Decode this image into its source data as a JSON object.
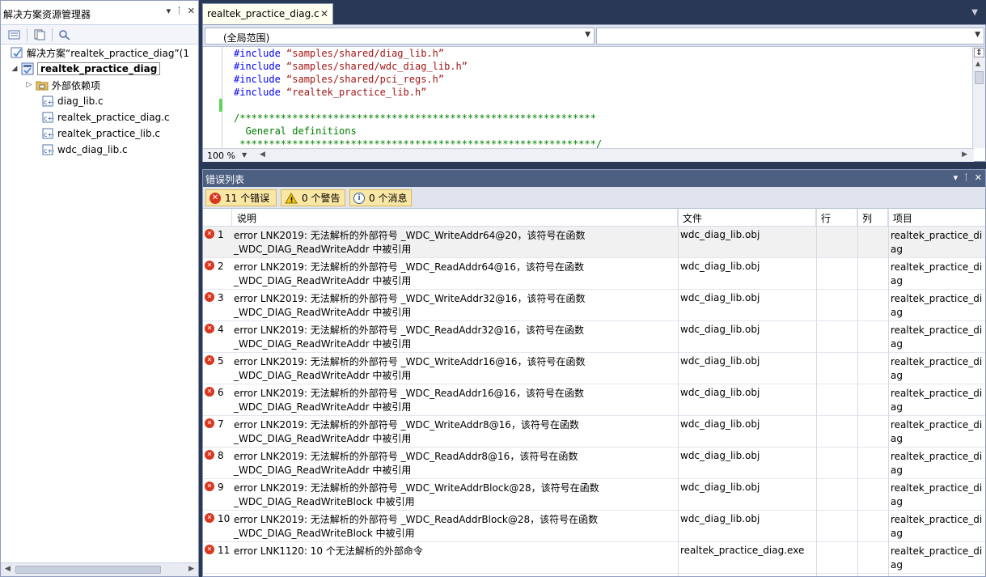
{
  "solution_explorer": {
    "title": "解决方案资源管理器",
    "solution_label": "解决方案“realtek_practice_diag”(1",
    "project": "realtek_practice_diag",
    "external_deps": "外部依赖项",
    "files": [
      "diag_lib.c",
      "realtek_practice_diag.c",
      "realtek_practice_lib.c",
      "wdc_diag_lib.c"
    ]
  },
  "editor": {
    "tab_label": "realtek_practice_diag.c",
    "scope_combo": "(全局范围)",
    "member_combo": "",
    "zoom": "100 %",
    "lines": [
      {
        "kw": "#include",
        "str": " “samples/shared/diag_lib.h”"
      },
      {
        "kw": "#include",
        "str": " “samples/shared/wdc_diag_lib.h”"
      },
      {
        "kw": "#include",
        "str": " “samples/shared/pci_regs.h”"
      },
      {
        "kw": "#include",
        "str": " “realtek_practice_lib.h”"
      }
    ],
    "comment_top": "/*************************************************************",
    "comment_mid": "  General definitions",
    "comment_bot": " *************************************************************/"
  },
  "error_list": {
    "title": "错误列表",
    "errors_btn": "11 个错误",
    "warnings_btn": "0 个警告",
    "messages_btn": "0 个消息",
    "columns": {
      "desc": "说明",
      "file": "文件",
      "line": "行",
      "col": "列",
      "project": "项目"
    },
    "rows": [
      {
        "num": "1",
        "desc1": "error LNK2019: 无法解析的外部符号 _WDC_WriteAddr64@20，该符号在函数",
        "desc2": "_WDC_DIAG_ReadWriteAddr 中被引用",
        "file": "wdc_diag_lib.obj",
        "project": "realtek_practice_diag"
      },
      {
        "num": "2",
        "desc1": "error LNK2019: 无法解析的外部符号 _WDC_ReadAddr64@16，该符号在函数",
        "desc2": "_WDC_DIAG_ReadWriteAddr 中被引用",
        "file": "wdc_diag_lib.obj",
        "project": "realtek_practice_diag"
      },
      {
        "num": "3",
        "desc1": "error LNK2019: 无法解析的外部符号 _WDC_WriteAddr32@16，该符号在函数",
        "desc2": "_WDC_DIAG_ReadWriteAddr 中被引用",
        "file": "wdc_diag_lib.obj",
        "project": "realtek_practice_diag"
      },
      {
        "num": "4",
        "desc1": "error LNK2019: 无法解析的外部符号 _WDC_ReadAddr32@16，该符号在函数",
        "desc2": "_WDC_DIAG_ReadWriteAddr 中被引用",
        "file": "wdc_diag_lib.obj",
        "project": "realtek_practice_diag"
      },
      {
        "num": "5",
        "desc1": "error LNK2019: 无法解析的外部符号 _WDC_WriteAddr16@16，该符号在函数",
        "desc2": "_WDC_DIAG_ReadWriteAddr 中被引用",
        "file": "wdc_diag_lib.obj",
        "project": "realtek_practice_diag"
      },
      {
        "num": "6",
        "desc1": "error LNK2019: 无法解析的外部符号 _WDC_ReadAddr16@16，该符号在函数",
        "desc2": "_WDC_DIAG_ReadWriteAddr 中被引用",
        "file": "wdc_diag_lib.obj",
        "project": "realtek_practice_diag"
      },
      {
        "num": "7",
        "desc1": "error LNK2019: 无法解析的外部符号 _WDC_WriteAddr8@16，该符号在函数",
        "desc2": "_WDC_DIAG_ReadWriteAddr 中被引用",
        "file": "wdc_diag_lib.obj",
        "project": "realtek_practice_diag"
      },
      {
        "num": "8",
        "desc1": "error LNK2019: 无法解析的外部符号 _WDC_ReadAddr8@16，该符号在函数",
        "desc2": "_WDC_DIAG_ReadWriteAddr 中被引用",
        "file": "wdc_diag_lib.obj",
        "project": "realtek_practice_diag"
      },
      {
        "num": "9",
        "desc1": "error LNK2019: 无法解析的外部符号 _WDC_WriteAddrBlock@28，该符号在函数",
        "desc2": "_WDC_DIAG_ReadWriteBlock 中被引用",
        "file": "wdc_diag_lib.obj",
        "project": "realtek_practice_diag"
      },
      {
        "num": "10",
        "desc1": "error LNK2019: 无法解析的外部符号 _WDC_ReadAddrBlock@28，该符号在函数",
        "desc2": "_WDC_DIAG_ReadWriteBlock 中被引用",
        "file": "wdc_diag_lib.obj",
        "project": "realtek_practice_diag"
      },
      {
        "num": "11",
        "desc1": "error LNK1120: 10 个无法解析的外部命令",
        "desc2": "",
        "file": "realtek_practice_diag.exe",
        "project": "realtek_practice_diag"
      }
    ]
  },
  "colors": {
    "frame": "#293955",
    "error_title_bar": "#4d6082",
    "filter_button": "#fbe7a5",
    "error_icon": "#d9361e"
  }
}
